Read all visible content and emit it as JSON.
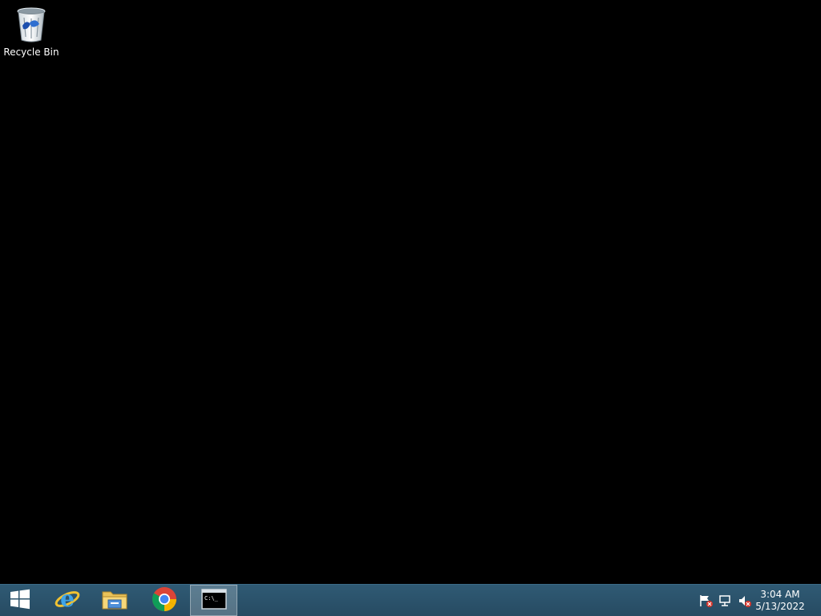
{
  "desktop": {
    "background_color": "#000000",
    "icons": [
      {
        "label": "Recycle Bin",
        "icon": "recycle-bin-icon"
      }
    ]
  },
  "taskbar": {
    "color": "#2b5269",
    "start": {
      "icon": "windows-logo-icon"
    },
    "pinned": [
      {
        "icon": "internet-explorer-icon"
      },
      {
        "icon": "file-explorer-icon"
      },
      {
        "icon": "chrome-icon"
      },
      {
        "icon": "command-prompt-icon",
        "active": true,
        "text": "C:\\_"
      }
    ],
    "tray": {
      "icons": [
        "action-center-flag-icon",
        "network-icon",
        "volume-muted-icon"
      ],
      "time": "3:04 AM",
      "date": "5/13/2022"
    }
  }
}
